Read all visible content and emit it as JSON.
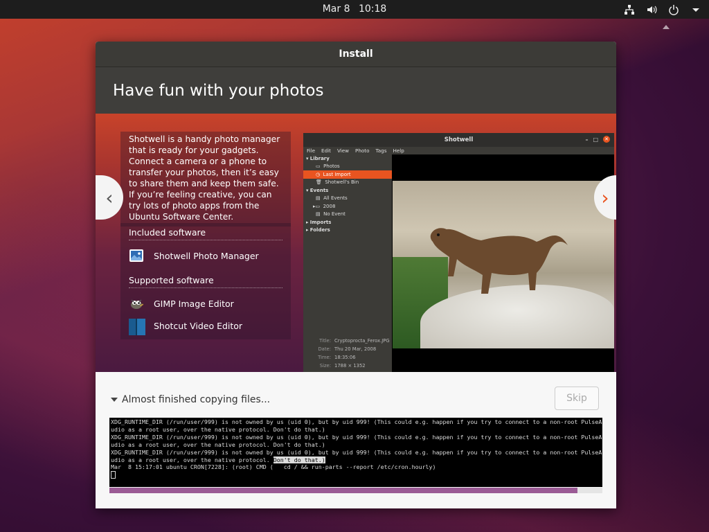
{
  "topbar": {
    "date": "Mar 8",
    "time": "10:18",
    "icons": [
      "network-icon",
      "volume-icon",
      "power-icon",
      "system-menu-arrow-icon"
    ]
  },
  "window": {
    "title": "Install",
    "slide_title": "Have fun with your photos",
    "description": "Shotwell is a handy photo manager that is ready for your gadgets. Connect a camera or a phone to transfer your photos, then it’s easy to share them and keep them safe. If you’re feeling creative, you can try lots of photo apps from the Ubuntu Software Center.",
    "included_heading": "Included software",
    "included": [
      {
        "label": "Shotwell Photo Manager",
        "icon": "shotwell-icon"
      }
    ],
    "supported_heading": "Supported software",
    "supported": [
      {
        "label": "GIMP Image Editor",
        "icon": "gimp-icon"
      },
      {
        "label": "Shotcut Video Editor",
        "icon": "shotcut-icon"
      }
    ],
    "prev_arrow": "‹",
    "next_arrow": "›"
  },
  "shotwell": {
    "title": "Shotwell",
    "menu": [
      "File",
      "Edit",
      "View",
      "Photo",
      "Tags",
      "Help"
    ],
    "sidebar": {
      "library": "Library",
      "photos": "Photos",
      "last_import": "Last Import",
      "bin": "Shotwell's Bin",
      "events": "Events",
      "all_events": "All Events",
      "year": "2008",
      "no_event": "No Event",
      "imports": "Imports",
      "folders": "Folders"
    },
    "meta": [
      {
        "k": "Title:",
        "v": "Cryptoprocta_Ferox.JPG"
      },
      {
        "k": "Date:",
        "v": "Thu 20 Mar, 2008"
      },
      {
        "k": "Time:",
        "v": "18:35:06"
      },
      {
        "k": "Size:",
        "v": "1788 × 1352"
      }
    ]
  },
  "install": {
    "status": "Almost finished copying files...",
    "skip_label": "Skip",
    "progress": 0.95,
    "terminal": [
      "XDG_RUNTIME_DIR (/run/user/999) is not owned by us (uid 0), but by uid 999! (This could e.g. happen if you try to connect to a non-root PulseA",
      "udio as a root user, over the native protocol. Don't do that.)",
      "XDG_RUNTIME_DIR (/run/user/999) is not owned by us (uid 0), but by uid 999! (This could e.g. happen if you try to connect to a non-root PulseA",
      "udio as a root user, over the native protocol. Don't do that.)",
      "XDG_RUNTIME_DIR (/run/user/999) is not owned by us (uid 0), but by uid 999! (This could e.g. happen if you try to connect to a non-root PulseA",
      "udio as a root user, over the native protocol. ",
      "Mar  8 15:17:01 ubuntu CRON[7228]: (root) CMD (   cd / && run-parts --report /etc/cron.hourly)"
    ],
    "terminal_highlight": "Don't do that.)"
  }
}
